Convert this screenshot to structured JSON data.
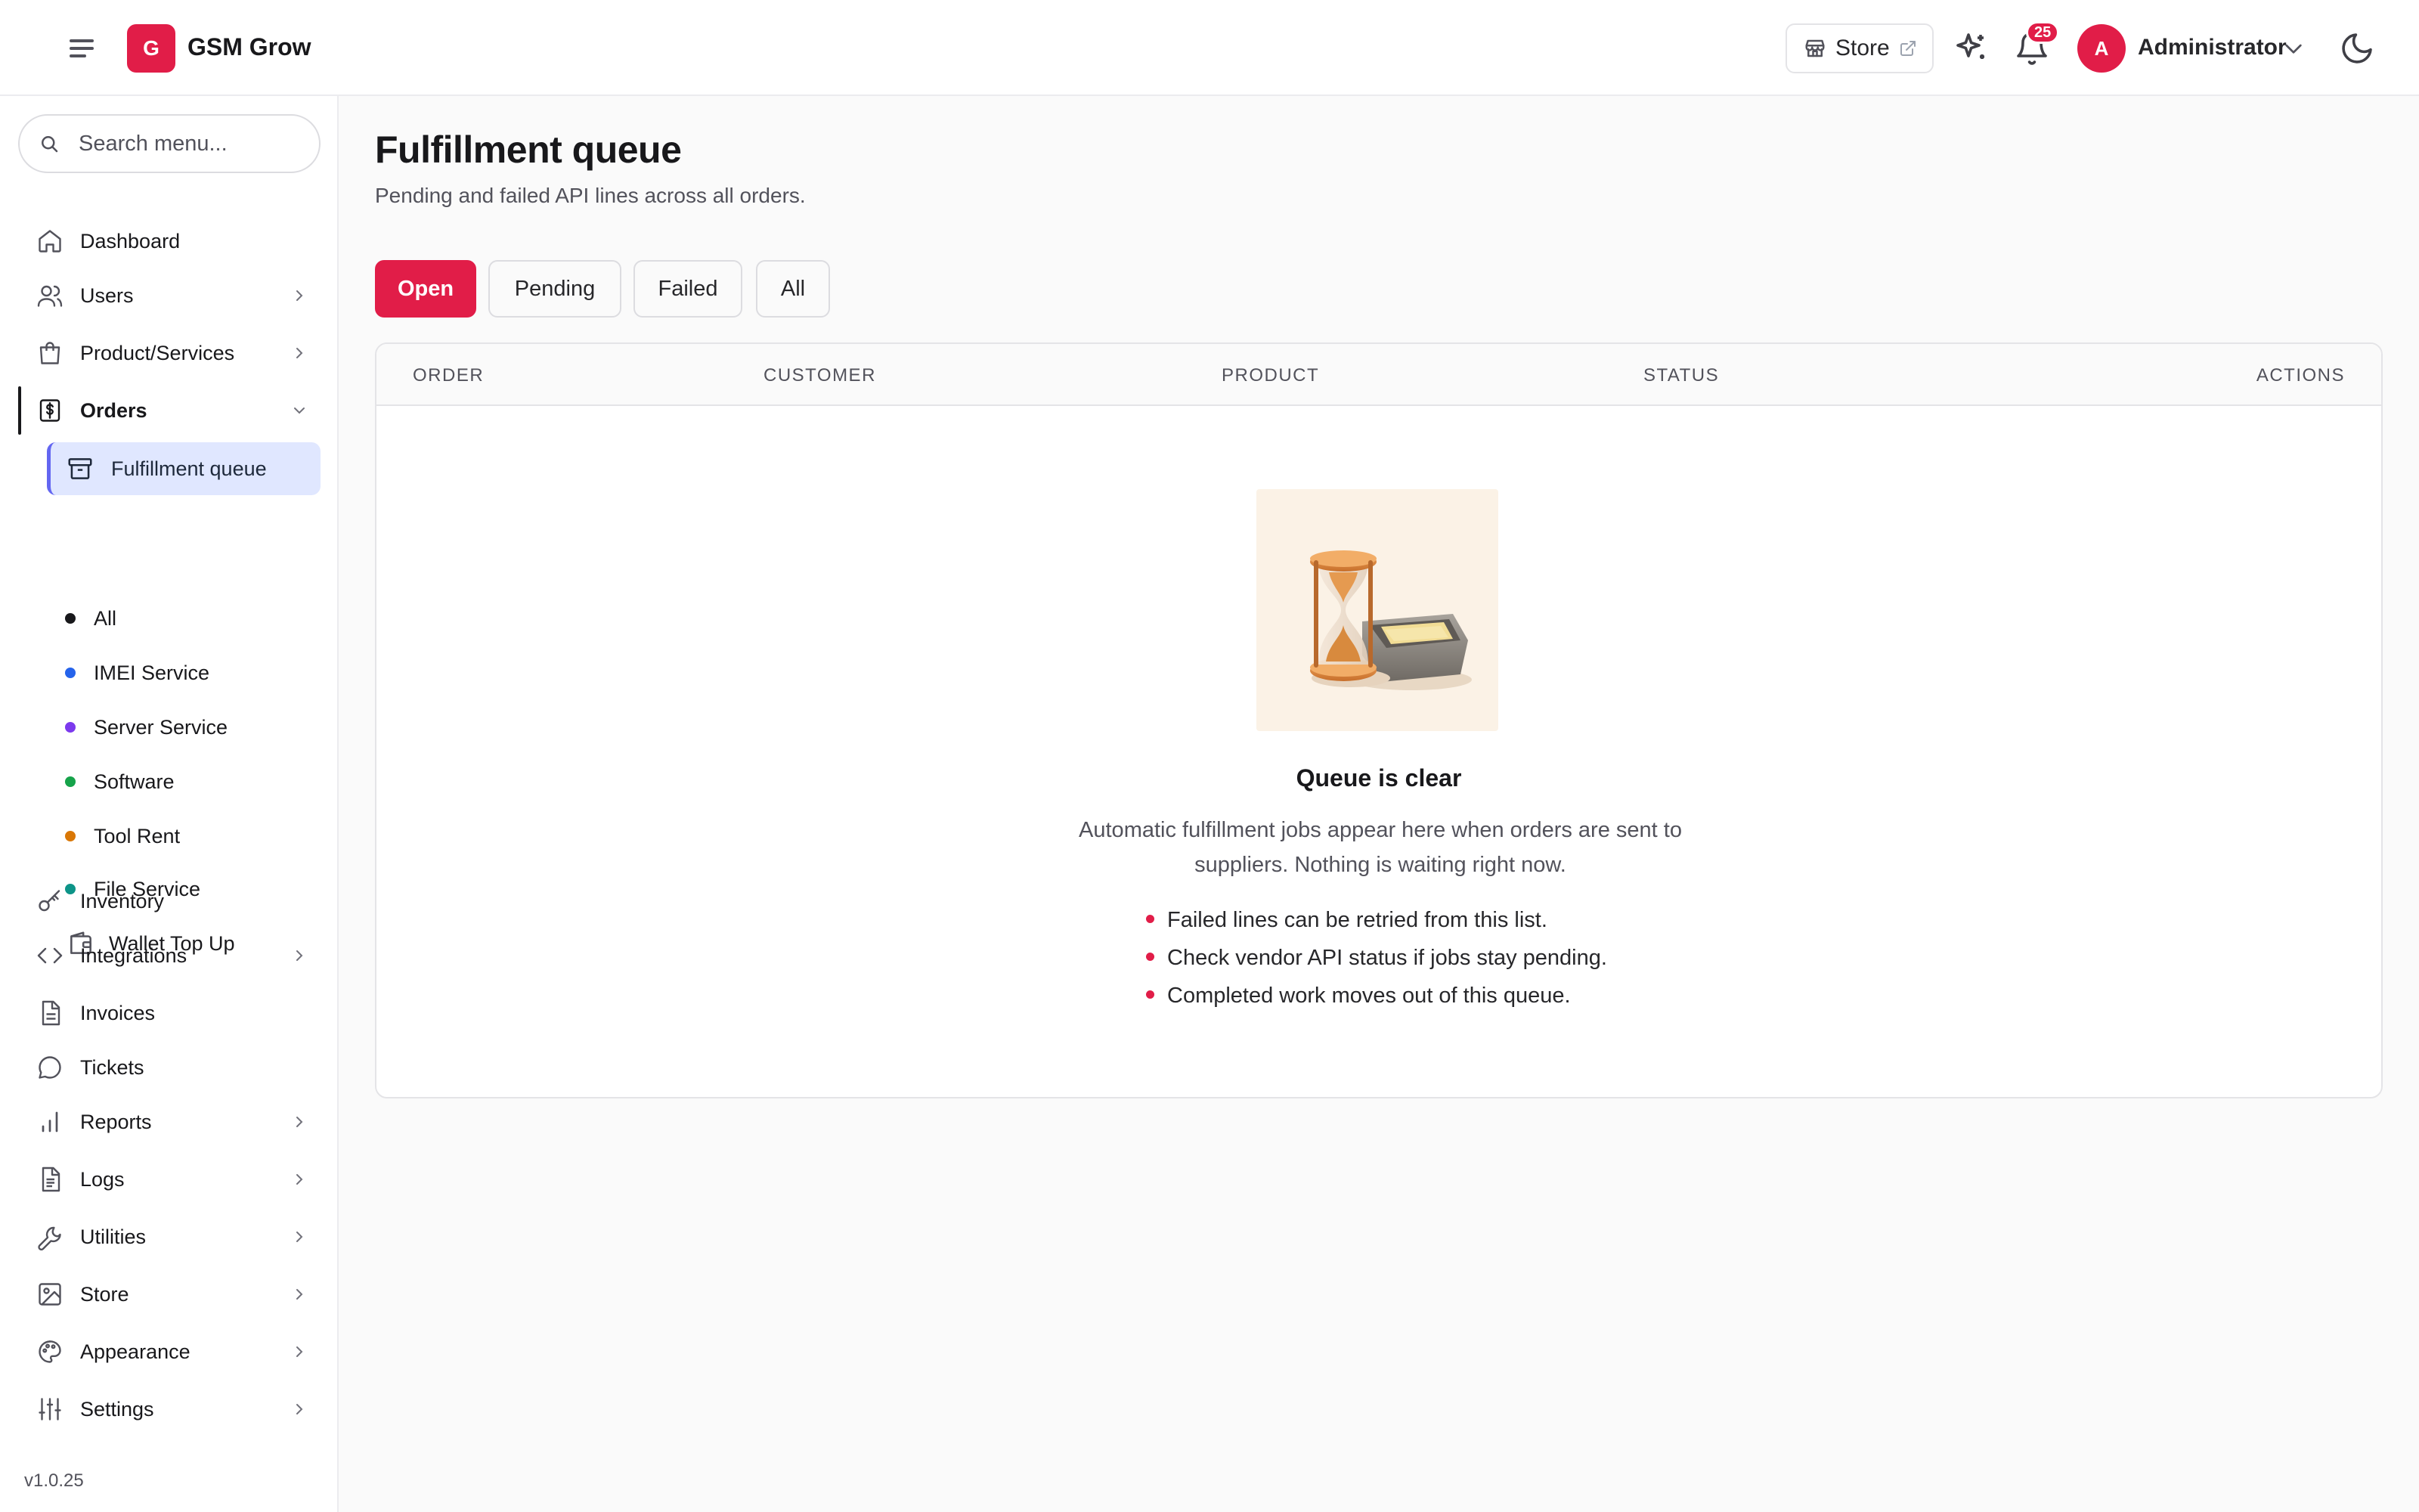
{
  "app": {
    "logo_letter": "G",
    "name": "GSM Grow",
    "version": "v1.0.25"
  },
  "header": {
    "store_label": "Store",
    "notification_count": "25",
    "user_initial": "A",
    "user_name": "Administrator"
  },
  "sidebar": {
    "search_placeholder": "Search menu...",
    "items": {
      "dashboard": "Dashboard",
      "users": "Users",
      "products": "Product/Services",
      "orders": "Orders",
      "inventory": "Inventory",
      "integrations": "Integrations",
      "invoices": "Invoices",
      "tickets": "Tickets",
      "reports": "Reports",
      "logs": "Logs",
      "utilities": "Utilities",
      "store": "Store",
      "appearance": "Appearance",
      "settings": "Settings"
    },
    "orders_sub": {
      "fulfillment": "Fulfillment queue",
      "all": "All",
      "imei": "IMEI Service",
      "server": "Server Service",
      "software": "Software",
      "tool_rent": "Tool Rent",
      "file": "File Service",
      "wallet": "Wallet Top Up"
    },
    "dot_colors": {
      "all": "#18181b",
      "imei": "#2563eb",
      "server": "#7c3aed",
      "software": "#16a34a",
      "tool_rent": "#d97706",
      "file": "#0d9488"
    }
  },
  "main": {
    "title": "Fulfillment queue",
    "subtitle": "Pending and failed API lines across all orders.",
    "tabs": {
      "open": "Open",
      "pending": "Pending",
      "failed": "Failed",
      "all": "All"
    },
    "table": {
      "columns": {
        "order": "ORDER",
        "customer": "CUSTOMER",
        "product": "PRODUCT",
        "status": "STATUS",
        "actions": "ACTIONS"
      }
    },
    "empty": {
      "title": "Queue is clear",
      "description": "Automatic fulfillment jobs appear here when orders are sent to suppliers. Nothing is waiting right now.",
      "tips": [
        "Failed lines can be retried from this list.",
        "Check vendor API status if jobs stay pending.",
        "Completed work moves out of this queue."
      ]
    }
  },
  "colors": {
    "accent": "#e11d48",
    "active_bg": "#e0e7ff",
    "active_border": "#6366f1"
  }
}
